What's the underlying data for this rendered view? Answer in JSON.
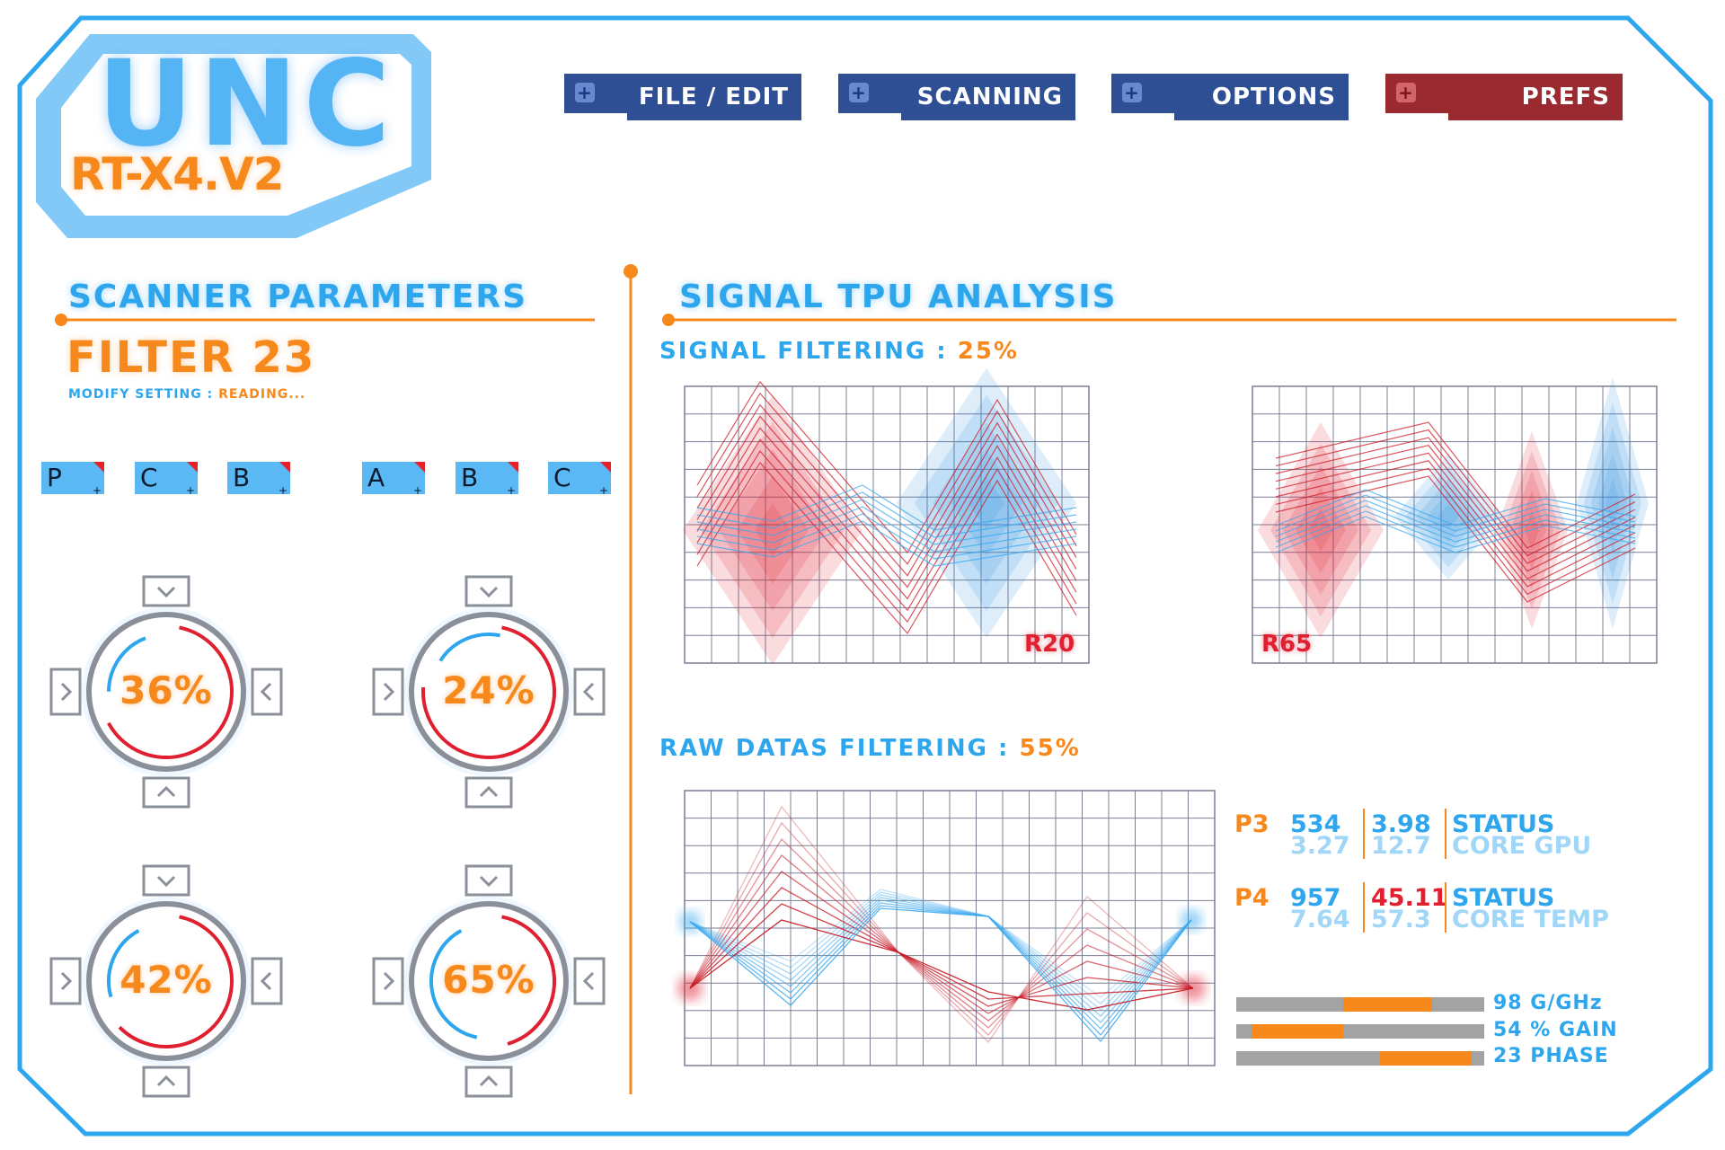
{
  "logo": {
    "name": "UNC",
    "model": "RT-X4.V2"
  },
  "menu": [
    {
      "label": "FILE / EDIT",
      "icon": "plus-icon"
    },
    {
      "label": "SCANNING",
      "icon": "plus-icon"
    },
    {
      "label": "OPTIONS",
      "icon": "plus-icon"
    },
    {
      "label": "PREFS",
      "icon": "plus-icon"
    }
  ],
  "scanner": {
    "title": "SCANNER PARAMETERS",
    "filter_label": "FILTER",
    "filter_value": "23",
    "modify_label": "MODIFY SETTING :",
    "modify_status": "READING...",
    "tags": [
      "P",
      "C",
      "B",
      "A",
      "B",
      "C"
    ],
    "dials": [
      {
        "value": "36%",
        "level": 0.36
      },
      {
        "value": "24%",
        "level": 0.24
      },
      {
        "value": "42%",
        "level": 0.42
      },
      {
        "value": "65%",
        "level": 0.65
      }
    ]
  },
  "analysis": {
    "title": "SIGNAL TPU ANALYSIS",
    "signal_filtering_label": "SIGNAL FILTERING :",
    "signal_filtering_value": "25%",
    "raw_filtering_label": "RAW DATAS FILTERING :",
    "raw_filtering_value": "55%",
    "chart_left_label": "R20",
    "chart_right_label": "R65"
  },
  "stats": [
    {
      "id": "P3",
      "v1": "534",
      "v1b": "3.27",
      "v2": "3.98",
      "v2b": "12.7",
      "status": "STATUS",
      "sub": "CORE GPU"
    },
    {
      "id": "P4",
      "v1": "957",
      "v1b": "7.64",
      "v2": "45.11",
      "v2b": "57.3",
      "status": "STATUS",
      "sub": "CORE TEMP"
    }
  ],
  "bars": [
    {
      "label": "98 G/GHz",
      "start": 0.43,
      "end": 0.79
    },
    {
      "label": "54 % GAIN",
      "start": 0.06,
      "end": 0.43
    },
    {
      "label": "23 PHASE",
      "start": 0.58,
      "end": 0.95
    }
  ],
  "colors": {
    "blue": "#2ea6ee",
    "orange": "#f7891c",
    "red": "#e02030",
    "menu": "#2f4f95",
    "prefs": "#9a2a2f"
  }
}
